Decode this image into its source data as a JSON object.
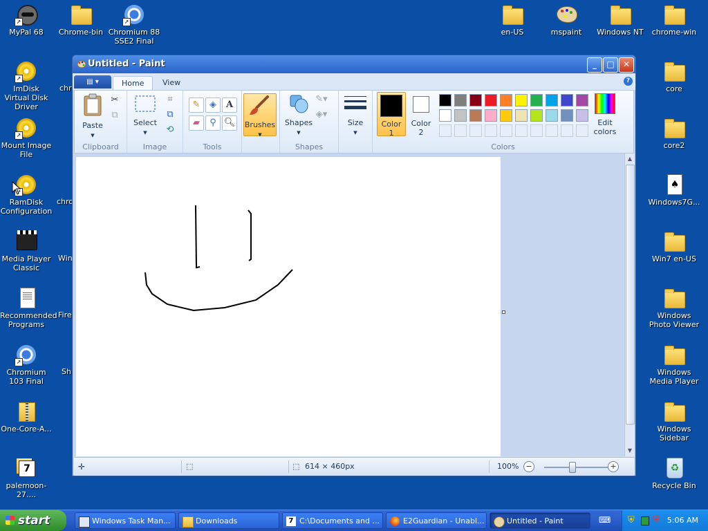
{
  "desktop": {
    "left_icons": [
      {
        "label": "MyPal 68",
        "icon": "raccoon-icon"
      },
      {
        "label": "ImDisk Virtual Disk Driver",
        "icon": "disc-icon"
      },
      {
        "label": "Mount Image File",
        "icon": "disc-icon"
      },
      {
        "label": "RamDisk Configuration",
        "icon": "disc-icon"
      },
      {
        "label": "Media Player Classic",
        "icon": "clapper-icon"
      },
      {
        "label": "Recommended Programs",
        "icon": "document-icon"
      },
      {
        "label": "Chromium 103 Final",
        "icon": "chromium-icon"
      },
      {
        "label": "One-Core-A...",
        "icon": "zip-folder-icon"
      },
      {
        "label": "palemoon-27....",
        "icon": "archive-icon"
      }
    ],
    "second_col_icons": [
      {
        "label": "Chrome-bin",
        "icon": "folder-icon"
      },
      {
        "label": "Chromium 88 SSE2 Final",
        "icon": "chromium-icon"
      }
    ],
    "partial_labels": [
      "chr",
      "chro",
      "Win",
      "Fire",
      "Sh"
    ],
    "right_top_icons": [
      {
        "label": "en-US",
        "icon": "folder-icon"
      },
      {
        "label": "mspaint",
        "icon": "palette-icon"
      },
      {
        "label": "Windows NT",
        "icon": "folder-icon"
      },
      {
        "label": "chrome-win",
        "icon": "folder-icon"
      }
    ],
    "right_icons": [
      {
        "label": "core",
        "icon": "folder-icon"
      },
      {
        "label": "core2",
        "icon": "folder-icon"
      },
      {
        "label": "Windows7G...",
        "icon": "cards-icon"
      },
      {
        "label": "Win7 en-US",
        "icon": "folder-icon"
      },
      {
        "label": "Windows Photo Viewer",
        "icon": "folder-icon"
      },
      {
        "label": "Windows Media Player",
        "icon": "folder-icon"
      },
      {
        "label": "Windows Sidebar",
        "icon": "folder-icon"
      },
      {
        "label": "Recycle Bin",
        "icon": "recycle-bin-icon"
      }
    ]
  },
  "paint": {
    "title": "Untitled - Paint",
    "tabs": [
      "Home",
      "View"
    ],
    "active_tab": "Home",
    "groups": {
      "clipboard": {
        "label": "Clipboard",
        "paste": "Paste"
      },
      "image": {
        "label": "Image",
        "select": "Select"
      },
      "tools": {
        "label": "Tools"
      },
      "brushes": {
        "label": "Brushes"
      },
      "shapes": {
        "label": "Shapes",
        "button": "Shapes"
      },
      "size": {
        "label": "Size"
      },
      "colors": {
        "label": "Colors",
        "color1_a": "Color",
        "color1_b": "1",
        "color2_a": "Color",
        "color2_b": "2",
        "edit_a": "Edit",
        "edit_b": "colors",
        "color1_value": "#000000",
        "color2_value": "#ffffff",
        "palette_row1": [
          "#000000",
          "#7f7f7f",
          "#880015",
          "#ed1c24",
          "#ff7f27",
          "#fff200",
          "#22b14c",
          "#00a2e8",
          "#3f48cc",
          "#a349a4"
        ],
        "palette_row2": [
          "#ffffff",
          "#c3c3c3",
          "#b97a57",
          "#ffaec9",
          "#ffc90e",
          "#efe4b0",
          "#b5e61d",
          "#99d9ea",
          "#7092be",
          "#c8bfe7"
        ]
      }
    },
    "status": {
      "dimensions": "614 × 460px",
      "zoom": "100%"
    }
  },
  "taskbar": {
    "start": "start",
    "tasks": [
      {
        "label": "Windows Task Man...",
        "icon": "task-manager-icon"
      },
      {
        "label": "Downloads",
        "icon": "folder-icon"
      },
      {
        "label": "C:\\Documents and ...",
        "icon": "7zip-icon"
      },
      {
        "label": "E2Guardian - Unabl...",
        "icon": "firefox-icon"
      },
      {
        "label": "Untitled - Paint",
        "icon": "paint-icon"
      }
    ],
    "clock": "5:06 AM"
  }
}
